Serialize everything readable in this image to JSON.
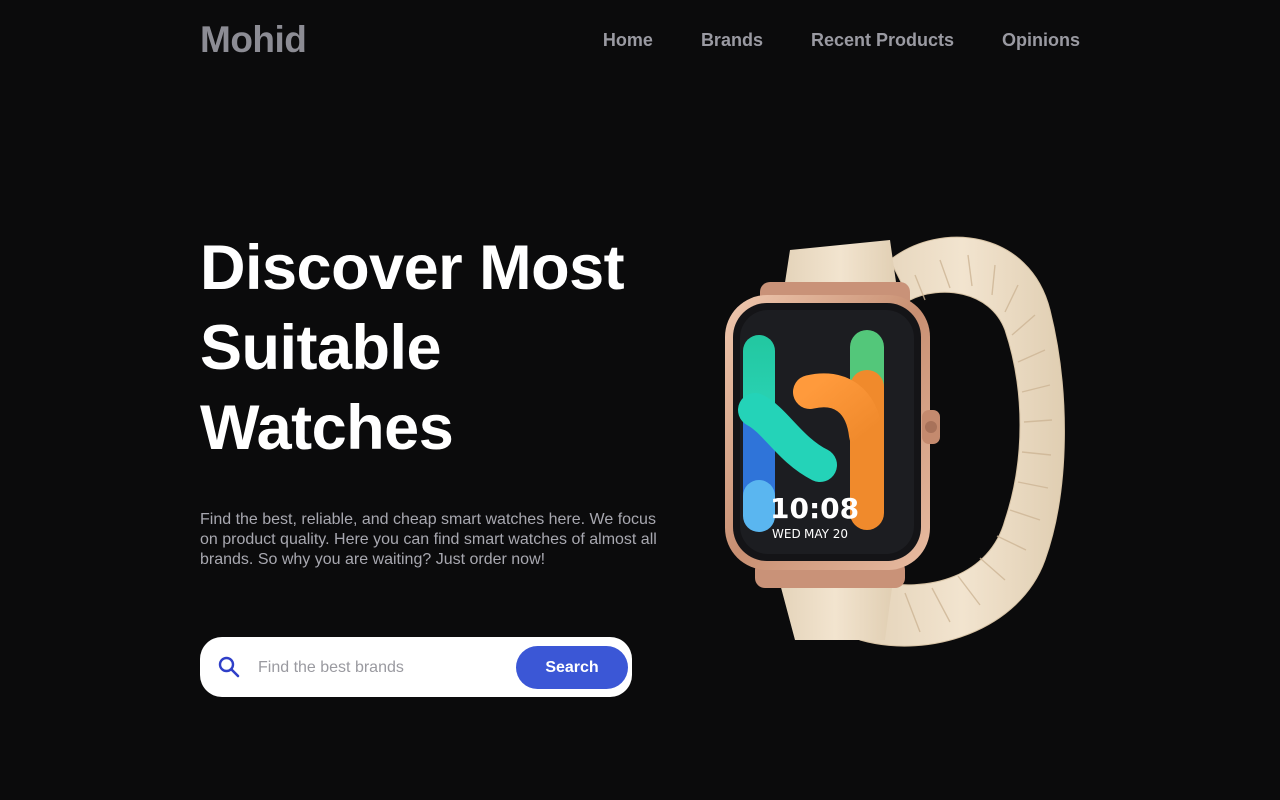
{
  "brand": {
    "logo": "Mohid"
  },
  "nav": {
    "items": [
      "Home",
      "Brands",
      "Recent Products",
      "Opinions"
    ]
  },
  "hero": {
    "title_lines": [
      "Discover Most",
      "Suitable",
      "Watches"
    ],
    "description": "Find the best, reliable, and cheap smart watches here. We focus on product quality. Here you can find smart watches of almost all brands. So why you are waiting? Just order now!"
  },
  "search": {
    "placeholder": "Find the best brands",
    "button_label": "Search",
    "icon": "search-icon"
  },
  "watch": {
    "time": "10:08",
    "day": "WED",
    "date": "MAY 20"
  },
  "colors": {
    "background": "#0b0b0c",
    "accent": "#3b57d6",
    "logo": "#8c8c94",
    "nav": "#9a9aa2",
    "strap": "#ecdcc4",
    "case": "#d7a488"
  }
}
